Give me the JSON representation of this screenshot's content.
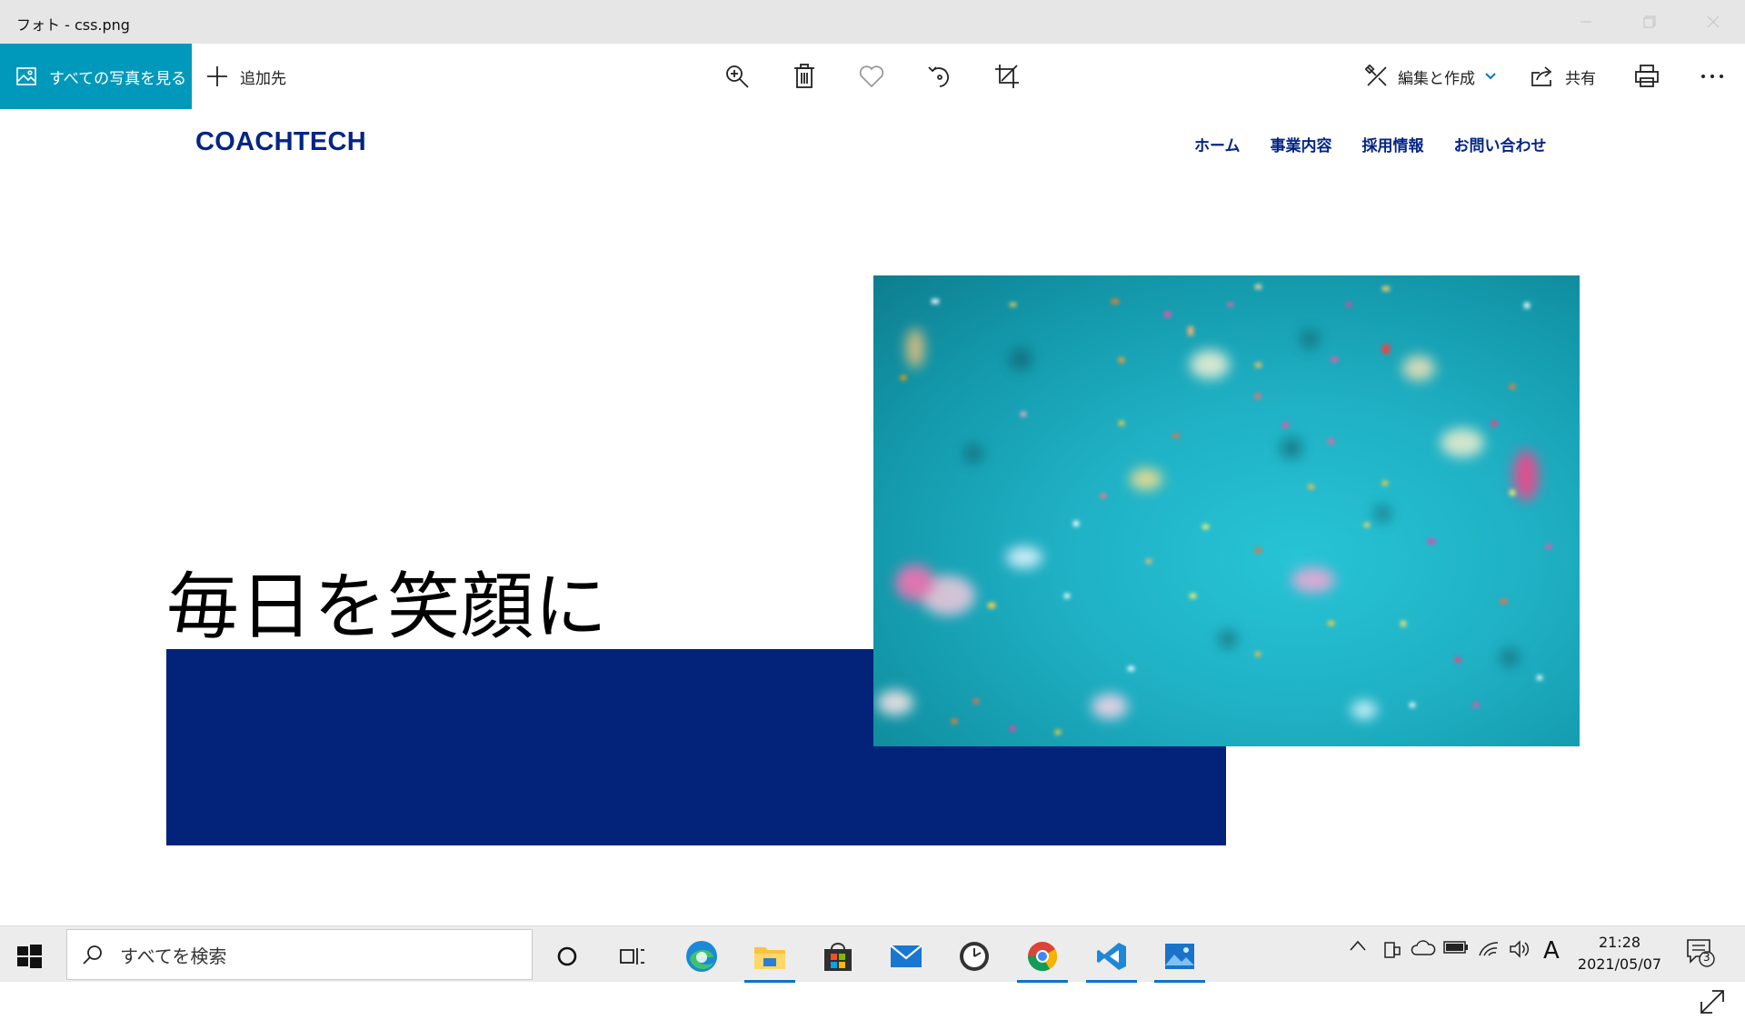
{
  "window": {
    "title": "フォト - css.png"
  },
  "toolbar": {
    "see_all_label": "すべての写真を見る",
    "add_to_label": "追加先",
    "edit_create_label": "編集と作成",
    "share_label": "共有",
    "accent_color": "#0099bc"
  },
  "site": {
    "logo": "COACHTECH",
    "nav": [
      "ホーム",
      "事業内容",
      "採用情報",
      "お問い合わせ"
    ],
    "hero_text": "毎日を笑顔に",
    "brand_color": "#032585",
    "block_color": "#03237a"
  },
  "taskbar": {
    "search_placeholder": "すべてを検索",
    "time": "21:28",
    "date": "2021/05/07",
    "ime": "A",
    "notification_count": "3",
    "apps": [
      "cortana-icon",
      "task-view-icon",
      "edge-icon",
      "file-explorer-icon",
      "store-icon",
      "mail-icon",
      "alarms-clock-icon",
      "chrome-icon",
      "vscode-icon",
      "photos-icon"
    ]
  }
}
